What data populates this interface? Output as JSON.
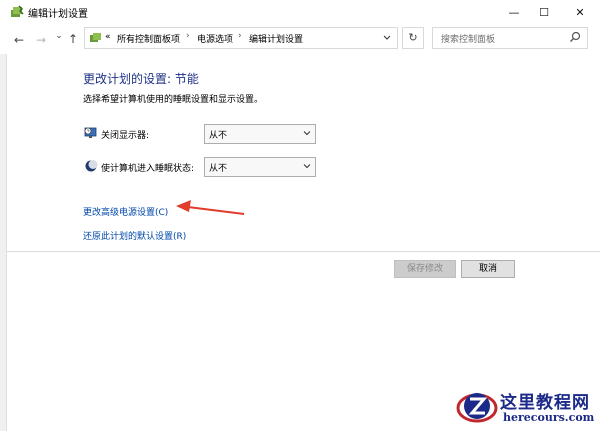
{
  "window": {
    "title": "编辑计划设置",
    "min_label": "—",
    "max_label": "☐",
    "close_label": "✕"
  },
  "nav": {
    "back_label": "←",
    "forward_label": "→",
    "recent_label": "⌄",
    "up_label": "↑",
    "breadcrumb_prefix": "«",
    "breadcrumbs": [
      "所有控制面板项",
      "电源选项",
      "编辑计划设置"
    ],
    "separator": "›",
    "refresh_label": "↻",
    "search_placeholder": "搜索控制面板"
  },
  "content": {
    "heading": "更改计划的设置: 节能",
    "subtitle": "选择希望计算机使用的睡眠设置和显示设置。",
    "display_off_label": "关闭显示器:",
    "display_off_value": "从不",
    "sleep_label": "使计算机进入睡眠状态:",
    "sleep_value": "从不",
    "advanced_link": "更改高级电源设置(C)",
    "restore_link": "还原此计划的默认设置(R)"
  },
  "buttons": {
    "save": "保存修改",
    "cancel": "取消"
  },
  "watermark": {
    "site_cn": "这里教程网",
    "site_en": "herecours.com"
  },
  "colors": {
    "heading": "#1e3287",
    "link": "#0047ab",
    "arrow": "#e23c2c",
    "watermark": "#1b2a88"
  }
}
